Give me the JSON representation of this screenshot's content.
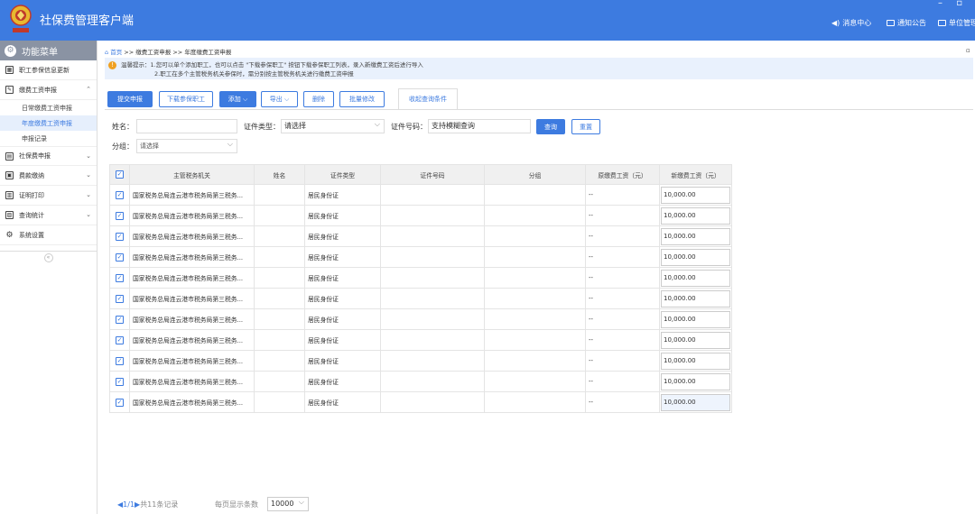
{
  "app": {
    "title": "社保费管理客户端",
    "window_controls": "– ▫"
  },
  "header": {
    "links": [
      {
        "label": "消息中心",
        "icon": "speaker-icon"
      },
      {
        "label": "通知公告",
        "icon": "mail-icon"
      },
      {
        "label": "单位管理",
        "icon": "building-icon"
      }
    ]
  },
  "sidebar": {
    "title": "功能菜单",
    "items": [
      {
        "label": "职工参保信息更新",
        "icon": "grid-icon",
        "chevron": ""
      },
      {
        "label": "缴费工资申报",
        "icon": "edit-icon",
        "chevron": "⌃"
      },
      {
        "label": "社保费申报",
        "icon": "doc-icon",
        "chevron": "⌄"
      },
      {
        "label": "费款缴纳",
        "icon": "save-icon",
        "chevron": "⌄"
      },
      {
        "label": "证明打印",
        "icon": "print-icon",
        "chevron": "⌄"
      },
      {
        "label": "查询统计",
        "icon": "chart-icon",
        "chevron": "⌄"
      },
      {
        "label": "系统设置",
        "icon": "gear-icon",
        "chevron": ""
      }
    ],
    "sub_items": [
      "日常缴费工资申报",
      "年度缴费工资申报",
      "申报记录"
    ],
    "active_sub": 1,
    "collapse": "«"
  },
  "breadcrumb": {
    "home": "首页",
    "sep": ">>",
    "level1": "缴费工资申报",
    "level2": "年度缴费工资申报"
  },
  "tip": {
    "line1": "温馨提示：1.您可以单个添加职工，也可以点击 \"下载参保职工\" 按钮下载参保职工列表，录入新缴费工资后进行导入",
    "line2": "2.职工在多个主管税务机关参保时，需分别按主管税务机关进行缴费工资申报"
  },
  "toolbar": {
    "submit": "提交申报",
    "download": "下载参保职工",
    "add": "添加",
    "export": "导出",
    "delete": "删除",
    "batch_edit": "批量修改",
    "query_tab": "收起查询条件"
  },
  "filters": {
    "name_label": "姓名：",
    "name_value": "",
    "idtype_label": "证件类型：",
    "idtype_value": "请选择",
    "idno_label": "证件号码：",
    "idno_placeholder": "支持模糊查询",
    "group_label": "分组：",
    "group_value": "请选择",
    "search": "查询",
    "reset": "重置"
  },
  "table": {
    "columns": [
      "主管税务机关",
      "姓名",
      "证件类型",
      "证件号码",
      "分组",
      "原缴费工资（元）",
      "新缴费工资（元）"
    ],
    "rows": [
      {
        "org": "国家税务总局连云港市税务局第三税务...",
        "name": "",
        "idtype": "居民身份证",
        "idno": "",
        "group": "",
        "old": "--",
        "new": "10,000.00"
      },
      {
        "org": "国家税务总局连云港市税务局第三税务...",
        "name": "",
        "idtype": "居民身份证",
        "idno": "",
        "group": "",
        "old": "--",
        "new": "10,000.00"
      },
      {
        "org": "国家税务总局连云港市税务局第三税务...",
        "name": "",
        "idtype": "居民身份证",
        "idno": "",
        "group": "",
        "old": "--",
        "new": "10,000.00"
      },
      {
        "org": "国家税务总局连云港市税务局第三税务...",
        "name": "",
        "idtype": "居民身份证",
        "idno": "",
        "group": "",
        "old": "--",
        "new": "10,000.00"
      },
      {
        "org": "国家税务总局连云港市税务局第三税务...",
        "name": "",
        "idtype": "居民身份证",
        "idno": "",
        "group": "",
        "old": "--",
        "new": "10,000.00"
      },
      {
        "org": "国家税务总局连云港市税务局第三税务...",
        "name": "",
        "idtype": "居民身份证",
        "idno": "",
        "group": "",
        "old": "--",
        "new": "10,000.00"
      },
      {
        "org": "国家税务总局连云港市税务局第三税务...",
        "name": "",
        "idtype": "居民身份证",
        "idno": "",
        "group": "",
        "old": "--",
        "new": "10,000.00"
      },
      {
        "org": "国家税务总局连云港市税务局第三税务...",
        "name": "",
        "idtype": "居民身份证",
        "idno": "",
        "group": "",
        "old": "--",
        "new": "10,000.00"
      },
      {
        "org": "国家税务总局连云港市税务局第三税务...",
        "name": "",
        "idtype": "居民身份证",
        "idno": "",
        "group": "",
        "old": "--",
        "new": "10,000.00"
      },
      {
        "org": "国家税务总局连云港市税务局第三税务...",
        "name": "",
        "idtype": "居民身份证",
        "idno": "",
        "group": "",
        "old": "--",
        "new": "10,000.00"
      },
      {
        "org": "国家税务总局连云港市税务局第三税务...",
        "name": "",
        "idtype": "居民身份证",
        "idno": "",
        "group": "",
        "old": "--",
        "new": "10,000.00"
      }
    ]
  },
  "pager": {
    "prev": "◀",
    "page": "1/1",
    "next": "▶",
    "total": "共11条记录",
    "size_label": "每页显示条数",
    "size_value": "10000"
  },
  "colors": {
    "accent": "#3d7be0",
    "header_bg": "#3d7be0",
    "sidebar_head": "#8a93a3",
    "tip_bg": "#e9f1fd",
    "warn": "#f0a020"
  }
}
